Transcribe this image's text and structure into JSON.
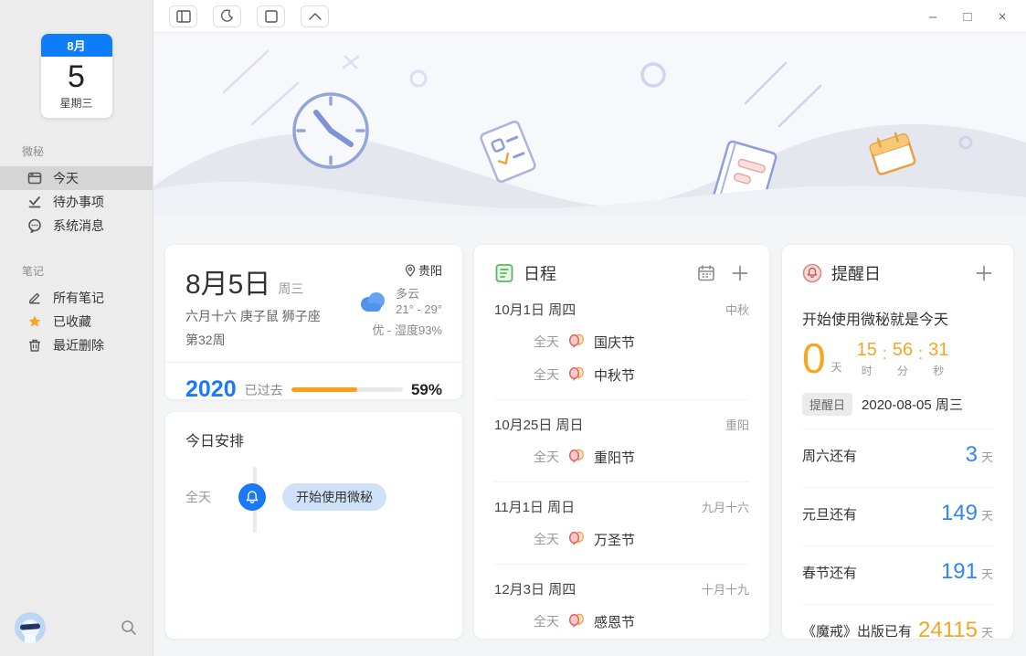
{
  "window_controls": {
    "minimize": "–",
    "maximize": "□",
    "close": "×"
  },
  "toolbar": {
    "buttons": [
      "toggle-sidebar",
      "dark-mode-moon",
      "window-layout",
      "collapse-banner"
    ]
  },
  "icons": {
    "location-pin": "⌖",
    "plus": "＋",
    "search": "🔍",
    "calendar": "📅",
    "bell": "🔔",
    "star": "★",
    "trash": "🗑",
    "pencil": "✎",
    "check": "✓",
    "message": "💬",
    "moon": "☾"
  },
  "colors": {
    "accent_blue": "#1a79f7",
    "accent_orange": "#f9a01b",
    "countdown_orange": "#f5a623",
    "value_blue": "#2f87f7",
    "sidebar_bg": "#ececec",
    "banner_bg": "#f7f8fb",
    "card_bg": "#ffffff",
    "content_bg": "#f4f5f7",
    "mini_cal_blue": "#0d7ef7"
  },
  "sidebar": {
    "date_card": {
      "month": "8月",
      "day": "5",
      "weekday": "星期三"
    },
    "sections": [
      {
        "title": "微秘",
        "items": [
          {
            "label": "今天",
            "icon": "calendar-icon",
            "active": true
          },
          {
            "label": "待办事项",
            "icon": "todo-check-icon",
            "active": false
          },
          {
            "label": "系统消息",
            "icon": "message-icon",
            "active": false
          }
        ]
      },
      {
        "title": "笔记",
        "items": [
          {
            "label": "所有笔记",
            "icon": "pencil-icon",
            "active": false
          },
          {
            "label": "已收藏",
            "icon": "star-icon",
            "active": false
          },
          {
            "label": "最近删除",
            "icon": "trash-icon",
            "active": false
          }
        ]
      }
    ]
  },
  "today_card": {
    "date": "8月5日",
    "weekday": "周三",
    "lunar": "六月十六 庚子鼠 狮子座",
    "week": "第32周",
    "city": "贵阳",
    "weather": "多云",
    "temp": "21° - 29°",
    "air": "优 - 湿度93%",
    "year": "2020",
    "passed_label": "已过去",
    "progress": 59,
    "percent": "59%"
  },
  "today_plan": {
    "title": "今日安排",
    "items": [
      {
        "time": "全天",
        "label": "开始使用微秘"
      }
    ]
  },
  "schedule": {
    "title": "日程",
    "groups": [
      {
        "date": "10月1日 周四",
        "tag": "中秋",
        "events": [
          {
            "time": "全天",
            "label": "国庆节"
          },
          {
            "time": "全天",
            "label": "中秋节"
          }
        ]
      },
      {
        "date": "10月25日 周日",
        "tag": "重阳",
        "events": [
          {
            "time": "全天",
            "label": "重阳节"
          }
        ]
      },
      {
        "date": "11月1日 周日",
        "tag": "九月十六",
        "events": [
          {
            "time": "全天",
            "label": "万圣节"
          }
        ]
      },
      {
        "date": "12月3日 周四",
        "tag": "十月十九",
        "events": [
          {
            "time": "全天",
            "label": "感恩节"
          }
        ]
      }
    ]
  },
  "reminders": {
    "title": "提醒日",
    "headline": "开始使用微秘就是今天",
    "countdown": {
      "days": "0",
      "days_unit": "天",
      "hh": "15",
      "mm": "56",
      "ss": "31",
      "h_label": "时",
      "m_label": "分",
      "s_label": "秒",
      "colon": ":"
    },
    "badge": "提醒日",
    "badge_date": "2020-08-05 周三",
    "rows": [
      {
        "label": "周六还有",
        "value": "3",
        "unit": "天",
        "color": "blue"
      },
      {
        "label": "元旦还有",
        "value": "149",
        "unit": "天",
        "color": "blue"
      },
      {
        "label": "春节还有",
        "value": "191",
        "unit": "天",
        "color": "blue"
      },
      {
        "label": "《魔戒》出版已有",
        "value": "24115",
        "unit": "天",
        "color": "orange"
      }
    ]
  }
}
